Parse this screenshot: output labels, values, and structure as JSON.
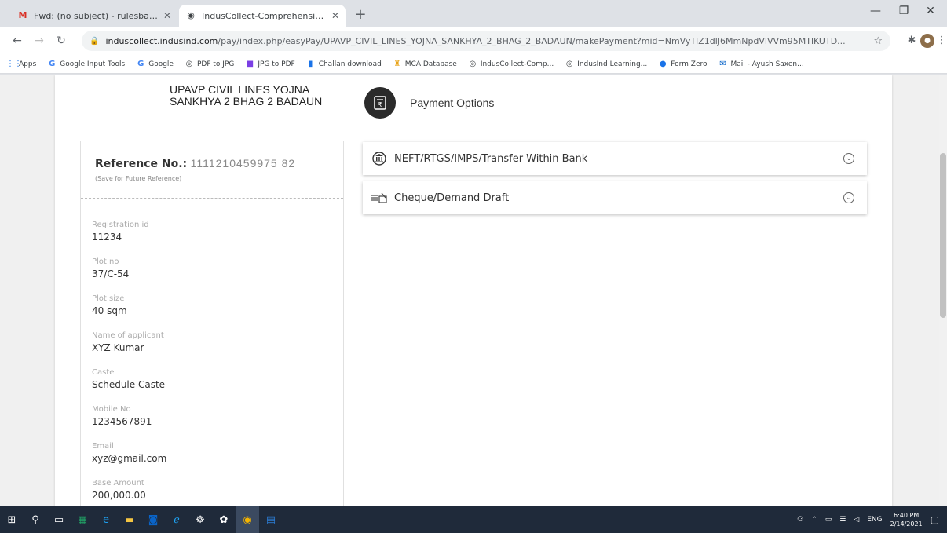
{
  "browser": {
    "tabs": [
      {
        "title": "Fwd: (no subject) - rulesbalensi...",
        "icon": "gmail-icon",
        "active": false
      },
      {
        "title": "IndusCollect-Comprehensive Co...",
        "icon": "induscollect-icon",
        "active": true
      }
    ],
    "url_domain": "induscollect.indusind.com",
    "url_path": "/pay/index.php/easyPay/UPAVP_CIVIL_LINES_YOJNA_SANKHYA_2_BHAG_2_BADAUN/makePayment?mid=NmVyTlZ1dlJ6MmNpdVlVVm95MTlKUTD...",
    "bookmarks": [
      {
        "label": "Apps",
        "icon": "apps-grid-icon"
      },
      {
        "label": "Google Input Tools",
        "icon": "google-icon"
      },
      {
        "label": "Google",
        "icon": "google-icon"
      },
      {
        "label": "PDF to JPG",
        "icon": "globe-icon"
      },
      {
        "label": "JPG to PDF",
        "icon": "jpg-pdf-icon"
      },
      {
        "label": "Challan download",
        "icon": "doc-icon"
      },
      {
        "label": "MCA Database",
        "icon": "mca-icon"
      },
      {
        "label": "IndusCollect-Comp...",
        "icon": "globe-icon"
      },
      {
        "label": "IndusInd Learning...",
        "icon": "globe-icon"
      },
      {
        "label": "Form Zero",
        "icon": "circle-icon"
      },
      {
        "label": "Mail - Ayush Saxen...",
        "icon": "mail-icon"
      }
    ]
  },
  "page": {
    "org_name": "UPAVP CIVIL LINES YOJNA SANKHYA 2 BHAG 2 BADAUN",
    "reference_label": "Reference No.:",
    "reference_value": "1111210459975 82",
    "reference_note": "(Save for Future Reference)",
    "fields": [
      {
        "label": "Registration id",
        "value": "11234"
      },
      {
        "label": "Plot no",
        "value": "37/C-54"
      },
      {
        "label": "Plot size",
        "value": "40 sqm"
      },
      {
        "label": "Name of applicant",
        "value": "XYZ Kumar"
      },
      {
        "label": "Caste",
        "value": "Schedule Caste"
      },
      {
        "label": "Mobile No",
        "value": "1234567891"
      },
      {
        "label": "Email",
        "value": "xyz@gmail.com"
      },
      {
        "label": "Base Amount",
        "value": "200,000.00"
      }
    ],
    "payment_title": "Payment Options",
    "options": [
      {
        "label": "NEFT/RTGS/IMPS/Transfer Within Bank",
        "icon": "bank-icon"
      },
      {
        "label": "Cheque/Demand Draft",
        "icon": "cheque-icon"
      }
    ]
  },
  "taskbar": {
    "language": "ENG",
    "time": "6:40 PM",
    "date": "2/14/2021"
  }
}
